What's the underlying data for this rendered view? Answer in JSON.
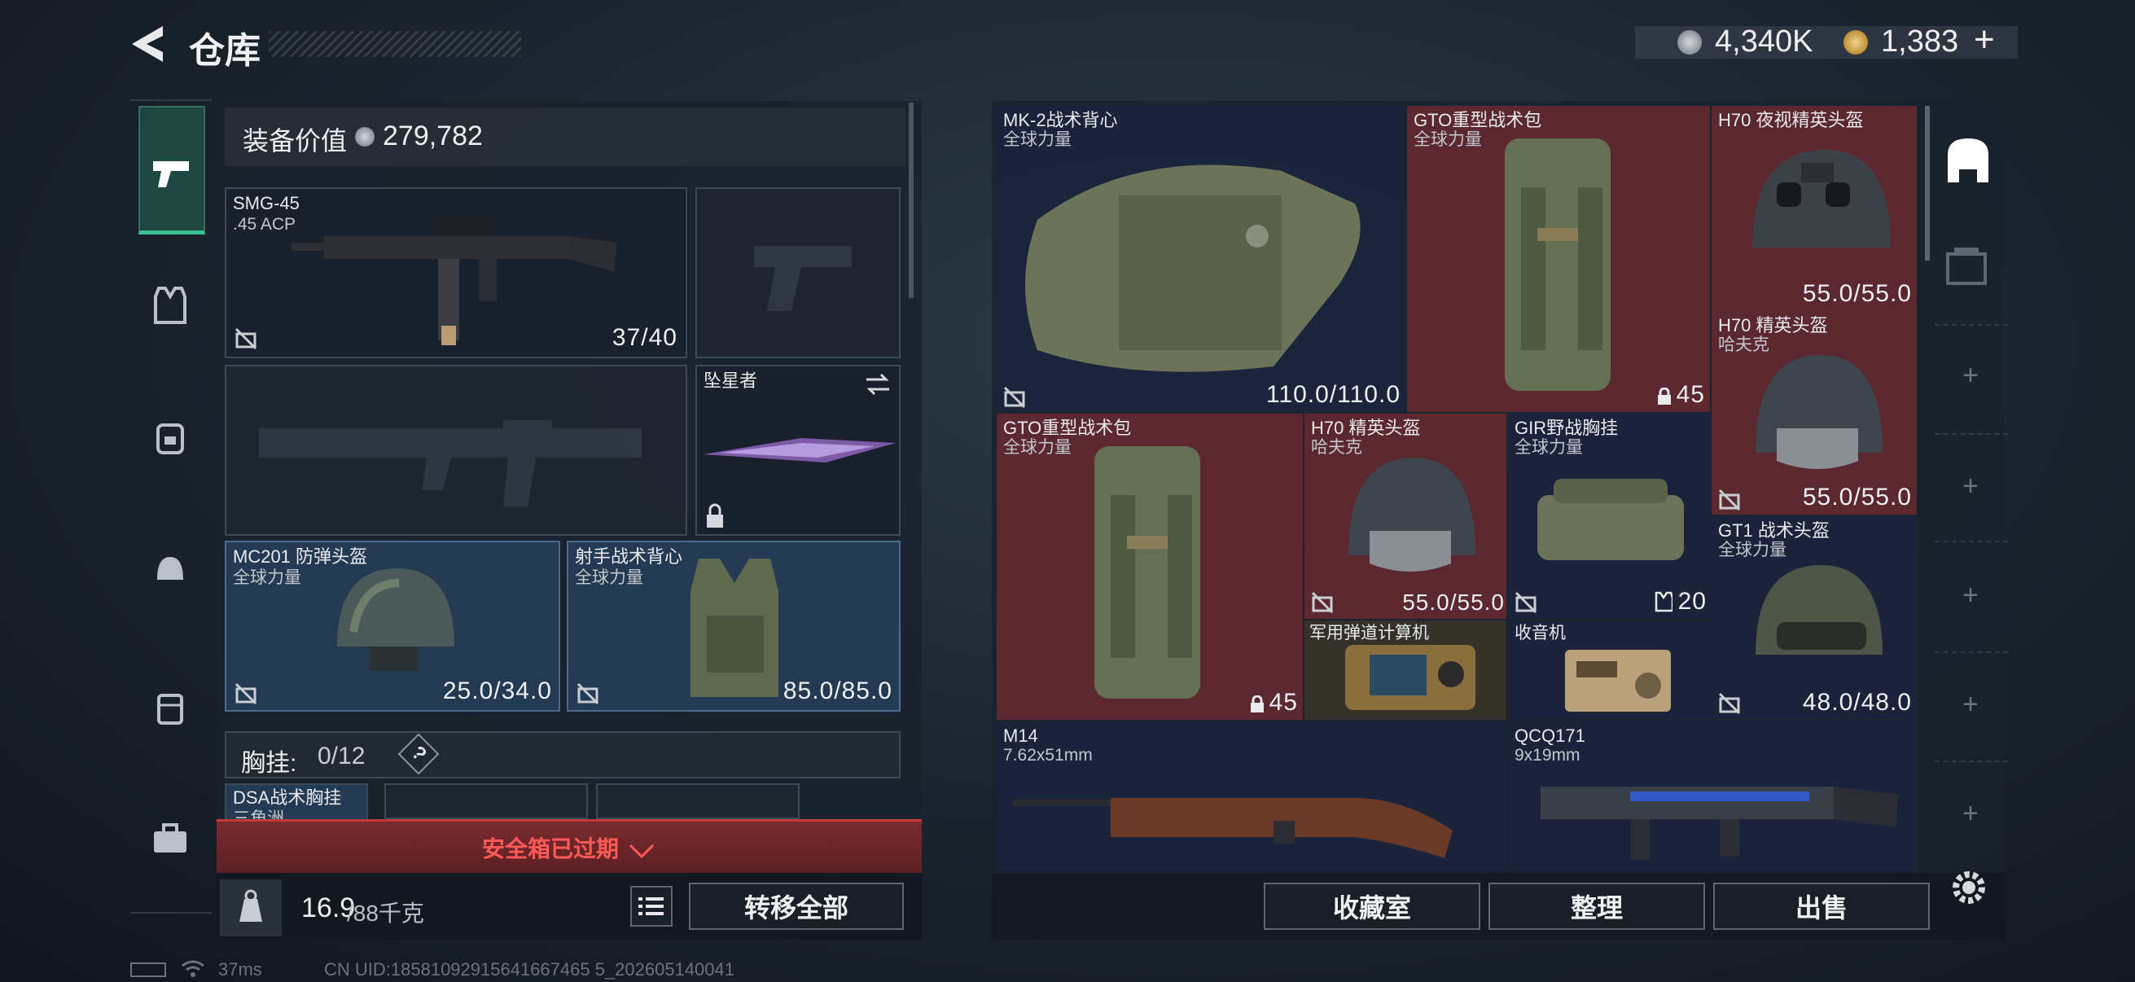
{
  "header": {
    "title": "仓库",
    "currency1": "4,340K",
    "currency2": "1,383",
    "currency2_add": "+"
  },
  "equipment": {
    "label": "装备价值",
    "value": "279,782"
  },
  "primary": {
    "name": "SMG-45",
    "ammo": ".45 ACP",
    "count": "37/40"
  },
  "melee": {
    "name": "坠星者"
  },
  "helmet": {
    "name": "MC201 防弹头盔",
    "faction": "全球力量",
    "durability": "25.0/34.0"
  },
  "vest": {
    "name": "射手战术背心",
    "faction": "全球力量",
    "durability": "85.0/85.0"
  },
  "chest_rig": {
    "label": "胸挂:",
    "count": "0/12",
    "help": "?",
    "item_name": "DSA战术胸挂",
    "item_faction": "三角洲"
  },
  "safe_box": {
    "text": "安全箱已过期"
  },
  "weight": {
    "current": "16.9",
    "max": "/88千克"
  },
  "buttons": {
    "transfer_all": "转移全部",
    "collection": "收藏室",
    "organize": "整理",
    "sell": "出售"
  },
  "grid": {
    "mk2": {
      "name": "MK-2战术背心",
      "faction": "全球力量",
      "durability": "110.0/110.0"
    },
    "gto1": {
      "name": "GTO重型战术包",
      "faction": "全球力量",
      "count": "45"
    },
    "h70nv": {
      "name": "H70 夜视精英头盔",
      "durability": "55.0/55.0"
    },
    "h70a": {
      "name": "H70 精英头盔",
      "faction": "哈夫克",
      "durability": "55.0/55.0"
    },
    "gto2": {
      "name": "GTO重型战术包",
      "faction": "全球力量",
      "count": "45"
    },
    "h70b": {
      "name": "H70 精英头盔",
      "faction": "哈夫克",
      "durability": "55.0/55.0"
    },
    "gir": {
      "name": "GIR野战胸挂",
      "faction": "全球力量",
      "count": "20"
    },
    "gt1": {
      "name": "GT1 战术头盔",
      "faction": "全球力量",
      "durability": "48.0/48.0"
    },
    "calc": {
      "name": "军用弹道计算机"
    },
    "radio": {
      "name": "收音机"
    },
    "m14": {
      "name": "M14",
      "ammo": "7.62x51mm"
    },
    "qcq": {
      "name": "QCQ171",
      "ammo": "9x19mm"
    }
  },
  "status": {
    "ping": "37ms",
    "uid": "CN UID:18581092915641667465 5_202605140041"
  }
}
